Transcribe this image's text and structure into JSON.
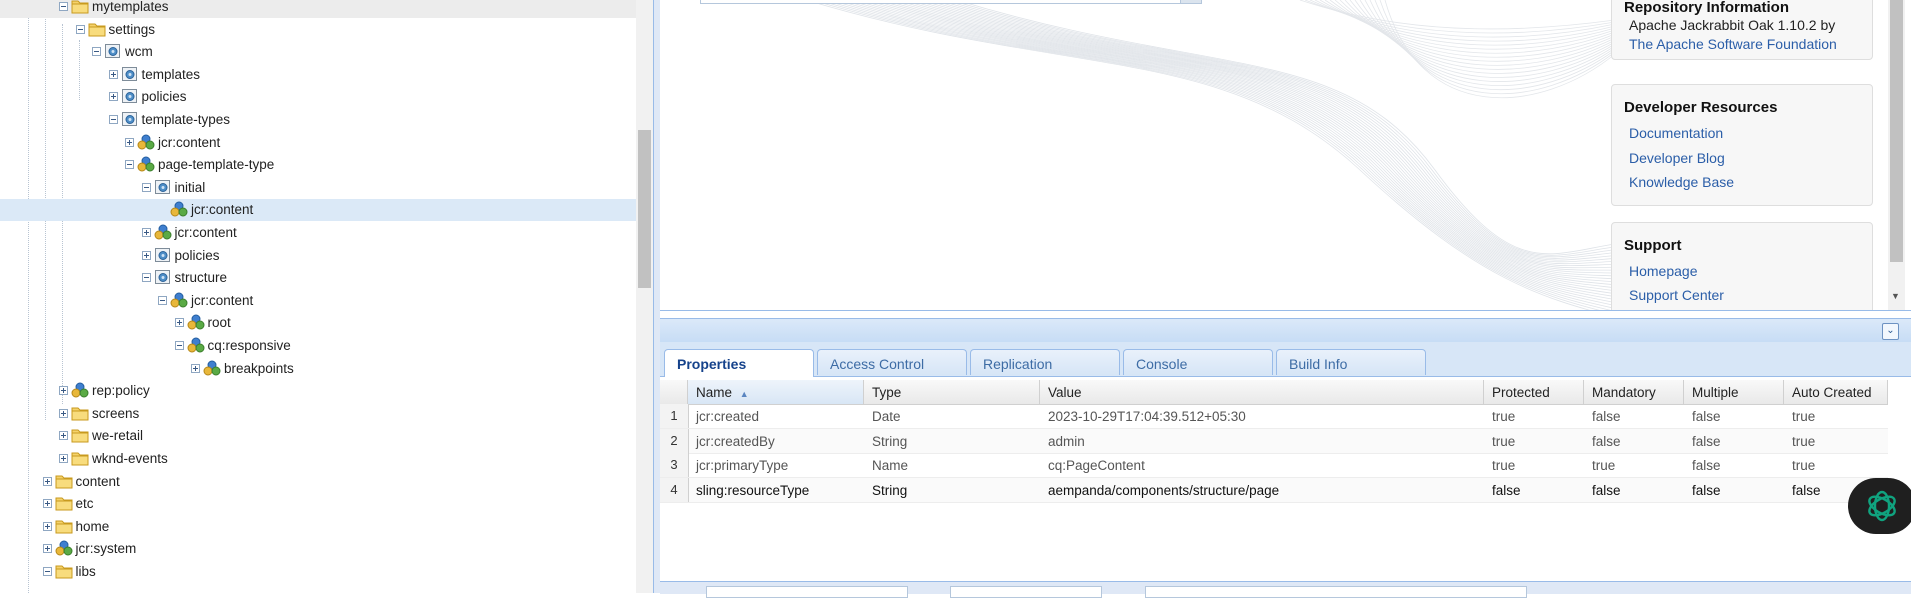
{
  "tree": {
    "nodes": [
      {
        "label": "mytemplates",
        "icon": "folder-icon",
        "toggle": "minus",
        "highlight": "gray"
      },
      {
        "label": "settings",
        "icon": "folder-icon",
        "toggle": "minus"
      },
      {
        "label": "wcm",
        "icon": "node-icon",
        "toggle": "minus"
      },
      {
        "label": "templates",
        "icon": "node-icon",
        "toggle": "plus"
      },
      {
        "label": "policies",
        "icon": "node-icon",
        "toggle": "plus"
      },
      {
        "label": "template-types",
        "icon": "node-icon",
        "toggle": "minus"
      },
      {
        "label": "jcr:content",
        "icon": "content-node-icon",
        "toggle": "plus"
      },
      {
        "label": "page-template-type",
        "icon": "content-node-icon",
        "toggle": "minus"
      },
      {
        "label": "initial",
        "icon": "node-icon",
        "toggle": "minus"
      },
      {
        "label": "jcr:content",
        "icon": "content-node-icon",
        "toggle": "none",
        "highlight": "selected"
      },
      {
        "label": "jcr:content",
        "icon": "content-node-icon",
        "toggle": "plus"
      },
      {
        "label": "policies",
        "icon": "node-icon",
        "toggle": "plus"
      },
      {
        "label": "structure",
        "icon": "node-icon",
        "toggle": "minus"
      },
      {
        "label": "jcr:content",
        "icon": "content-node-icon",
        "toggle": "minus"
      },
      {
        "label": "root",
        "icon": "content-node-icon",
        "toggle": "plus"
      },
      {
        "label": "cq:responsive",
        "icon": "content-node-icon",
        "toggle": "minus"
      },
      {
        "label": "breakpoints",
        "icon": "content-node-icon",
        "toggle": "plus"
      },
      {
        "label": "rep:policy",
        "icon": "content-node-icon",
        "toggle": "plus"
      },
      {
        "label": "screens",
        "icon": "folder-icon",
        "toggle": "plus"
      },
      {
        "label": "we-retail",
        "icon": "folder-icon",
        "toggle": "plus"
      },
      {
        "label": "wknd-events",
        "icon": "folder-icon",
        "toggle": "plus"
      },
      {
        "label": "content",
        "icon": "folder-icon",
        "toggle": "plus"
      },
      {
        "label": "etc",
        "icon": "folder-icon",
        "toggle": "plus"
      },
      {
        "label": "home",
        "icon": "folder-icon",
        "toggle": "plus"
      },
      {
        "label": "jcr:system",
        "icon": "content-node-icon",
        "toggle": "plus"
      },
      {
        "label": "libs",
        "icon": "folder-icon",
        "toggle": "minus"
      }
    ]
  },
  "welcome": {
    "repo_title": "Repository Information",
    "repo_text": "Apache Jackrabbit Oak 1.10.2 by",
    "repo_link": "The Apache Software Foundation",
    "dev_title": "Developer Resources",
    "dev_links": [
      "Documentation",
      "Developer Blog",
      "Knowledge Base"
    ],
    "support_title": "Support",
    "support_links": [
      "Homepage",
      "Support Center"
    ]
  },
  "tabs": [
    "Properties",
    "Access Control",
    "Replication",
    "Console",
    "Build Info"
  ],
  "grid": {
    "columns": [
      "Name",
      "Type",
      "Value",
      "Protected",
      "Mandatory",
      "Multiple",
      "Auto Created"
    ],
    "sort_indicator": "▲",
    "rows": [
      {
        "num": "1",
        "cells": [
          "jcr:created",
          "Date",
          "2023-10-29T17:04:39.512+05:30",
          "true",
          "false",
          "false",
          "true"
        ]
      },
      {
        "num": "2",
        "cells": [
          "jcr:createdBy",
          "String",
          "admin",
          "true",
          "false",
          "false",
          "true"
        ]
      },
      {
        "num": "3",
        "cells": [
          "jcr:primaryType",
          "Name",
          "cq:PageContent",
          "true",
          "true",
          "false",
          "true"
        ]
      },
      {
        "num": "4",
        "cells": [
          "sling:resourceType",
          "String",
          "aempanda/components/structure/page",
          "false",
          "false",
          "false",
          "false"
        ]
      }
    ]
  },
  "colors": {
    "tree_selected": "#dbe9f7",
    "panel_border": "#99bbe8",
    "link": "#2b5ea8",
    "fab_icon": "#10a37f"
  }
}
